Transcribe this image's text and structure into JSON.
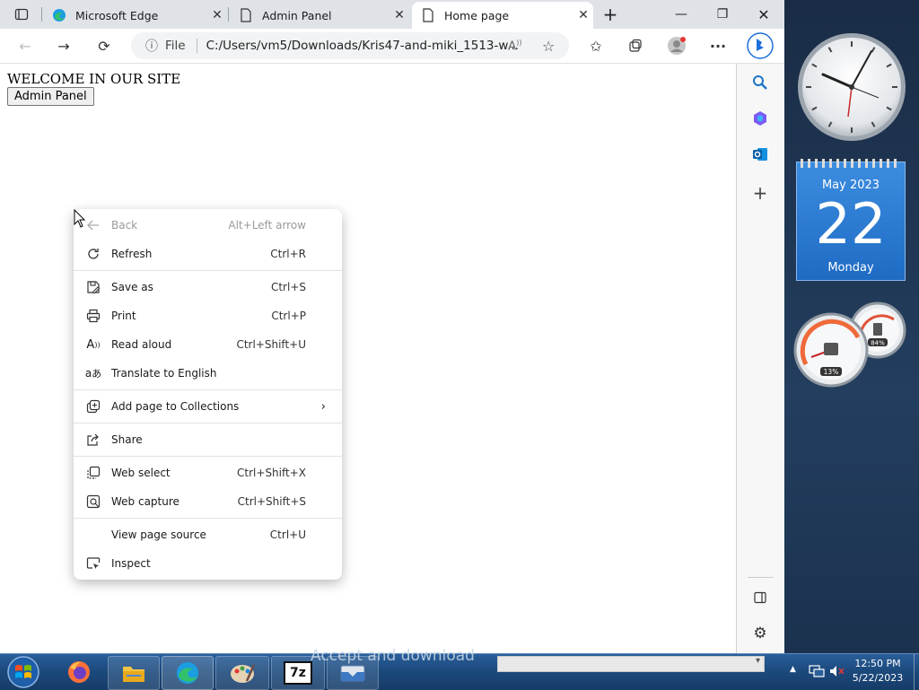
{
  "browser": {
    "tabs": [
      {
        "label": "Microsoft Edge",
        "icon": "edge-icon"
      },
      {
        "label": "Admin Panel",
        "icon": "page-icon"
      },
      {
        "label": "Home page",
        "icon": "page-icon",
        "active": true
      }
    ],
    "address": {
      "scheme_label": "File",
      "url": "C:/Users/vm5/Downloads/Kris47-and-miki_1513-w..."
    },
    "accent_color": "#0c59a4"
  },
  "page": {
    "heading": "WELCOME IN OUR SITE",
    "admin_button": "Admin Panel"
  },
  "context_menu": {
    "items": [
      {
        "label": "Back",
        "shortcut": "Alt+Left arrow",
        "icon": "back-arrow-icon",
        "disabled": true
      },
      {
        "label": "Refresh",
        "shortcut": "Ctrl+R",
        "icon": "refresh-icon"
      },
      {
        "label": "Save as",
        "shortcut": "Ctrl+S",
        "icon": "save-as-icon"
      },
      {
        "label": "Print",
        "shortcut": "Ctrl+P",
        "icon": "print-icon"
      },
      {
        "label": "Read aloud",
        "shortcut": "Ctrl+Shift+U",
        "icon": "read-aloud-icon"
      },
      {
        "label": "Translate to English",
        "shortcut": "",
        "icon": "translate-icon"
      },
      {
        "label": "Add page to Collections",
        "shortcut": "",
        "icon": "collections-icon",
        "submenu": true
      },
      {
        "label": "Share",
        "shortcut": "",
        "icon": "share-icon"
      },
      {
        "label": "Web select",
        "shortcut": "Ctrl+Shift+X",
        "icon": "web-select-icon"
      },
      {
        "label": "Web capture",
        "shortcut": "Ctrl+Shift+S",
        "icon": "web-capture-icon"
      },
      {
        "label": "View page source",
        "shortcut": "Ctrl+U",
        "icon": ""
      },
      {
        "label": "Inspect",
        "shortcut": "",
        "icon": "inspect-icon"
      }
    ]
  },
  "gadgets": {
    "calendar": {
      "month": "May 2023",
      "day": "22",
      "weekday": "Monday"
    },
    "meter": {
      "cpu": "13%",
      "memory": "84%"
    }
  },
  "taskbar": {
    "overlay_text": "Accept and download",
    "time": "12:50 PM",
    "date": "5/22/2023"
  }
}
